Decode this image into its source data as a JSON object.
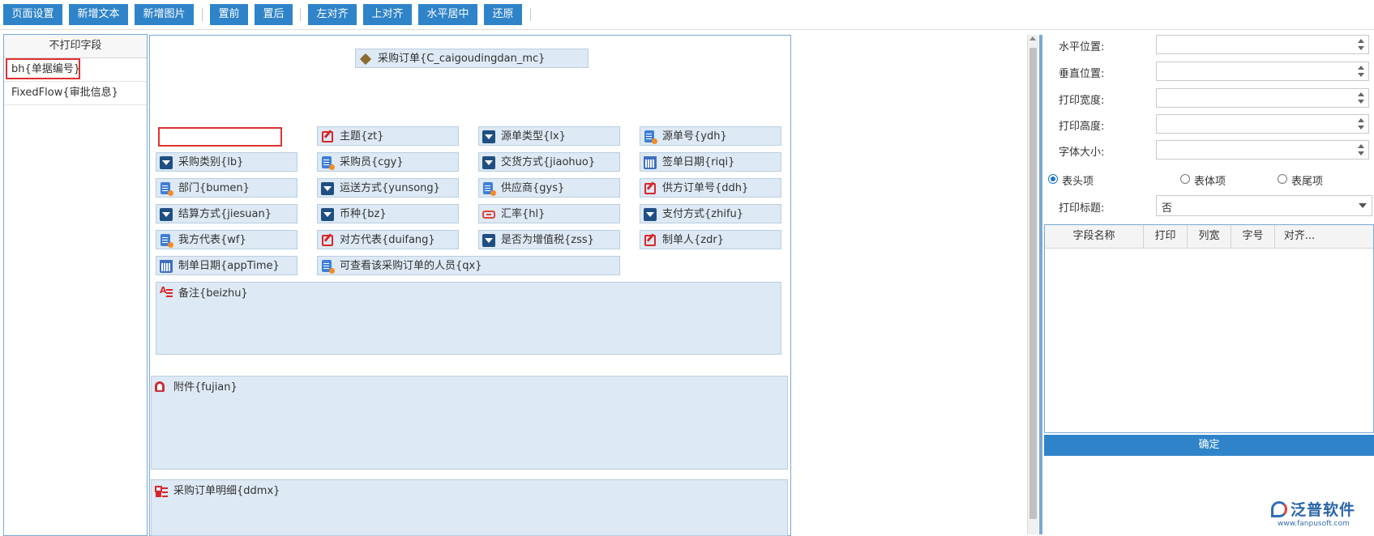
{
  "toolbar": {
    "buttons": [
      "页面设置",
      "新增文本",
      "新增图片",
      "置前",
      "置后",
      "左对齐",
      "上对齐",
      "水平居中",
      "还原"
    ]
  },
  "left_panel": {
    "title": "不打印字段",
    "items": [
      "bh{单据编号}",
      "FixedFlow{审批信息}"
    ]
  },
  "canvas": {
    "title_field": "采购订单{C_caigoudingdan_mc}",
    "fields": [
      {
        "label": "主题{zt}",
        "icon": "edit-icon"
      },
      {
        "label": "源单类型{lx}",
        "icon": "dropdown-icon"
      },
      {
        "label": "源单号{ydh}",
        "icon": "document-icon"
      },
      {
        "label": "采购类别{lb}",
        "icon": "dropdown-icon"
      },
      {
        "label": "采购员{cgy}",
        "icon": "document-icon"
      },
      {
        "label": "交货方式{jiaohuo}",
        "icon": "dropdown-icon"
      },
      {
        "label": "签单日期{riqi}",
        "icon": "calendar-icon"
      },
      {
        "label": "部门{bumen}",
        "icon": "document-icon"
      },
      {
        "label": "运送方式{yunsong}",
        "icon": "dropdown-icon"
      },
      {
        "label": "供应商{gys}",
        "icon": "document-icon"
      },
      {
        "label": "供方订单号{ddh}",
        "icon": "edit-icon"
      },
      {
        "label": "结算方式{jiesuan}",
        "icon": "dropdown-icon"
      },
      {
        "label": "币种{bz}",
        "icon": "dropdown-icon"
      },
      {
        "label": "汇率{hl}",
        "icon": "rate-icon"
      },
      {
        "label": "支付方式{zhifu}",
        "icon": "dropdown-icon"
      },
      {
        "label": "我方代表{wf}",
        "icon": "document-icon"
      },
      {
        "label": "对方代表{duifang}",
        "icon": "edit-icon"
      },
      {
        "label": "是否为增值税{zss}",
        "icon": "dropdown-icon"
      },
      {
        "label": "制单人{zdr}",
        "icon": "edit-icon"
      },
      {
        "label": "制单日期{appTime}",
        "icon": "calendar-icon"
      },
      {
        "label": "可查看该采购订单的人员{qx}",
        "icon": "document-icon"
      }
    ],
    "remark": "备注{beizhu}",
    "attachment": "附件{fujian}",
    "detail": "采购订单明细{ddmx}"
  },
  "right_panel": {
    "labels": [
      "水平位置:",
      "垂直位置:",
      "打印宽度:",
      "打印高度:",
      "字体大小:"
    ],
    "radios": [
      "表头项",
      "表体项",
      "表尾项"
    ],
    "selected_radio": "表头项",
    "print_title_label": "打印标题:",
    "print_title_value": "否",
    "grid_columns": [
      "字段名称",
      "打印",
      "列宽",
      "字号",
      "对齐..."
    ],
    "confirm": "确定"
  },
  "logo": {
    "name": "泛普软件",
    "url": "www.fanpusoft.com"
  },
  "colors": {
    "button": "#2f84c9",
    "field_bg": "#dde9f4",
    "border": "#7aa8d4",
    "highlight": "#e03131"
  }
}
